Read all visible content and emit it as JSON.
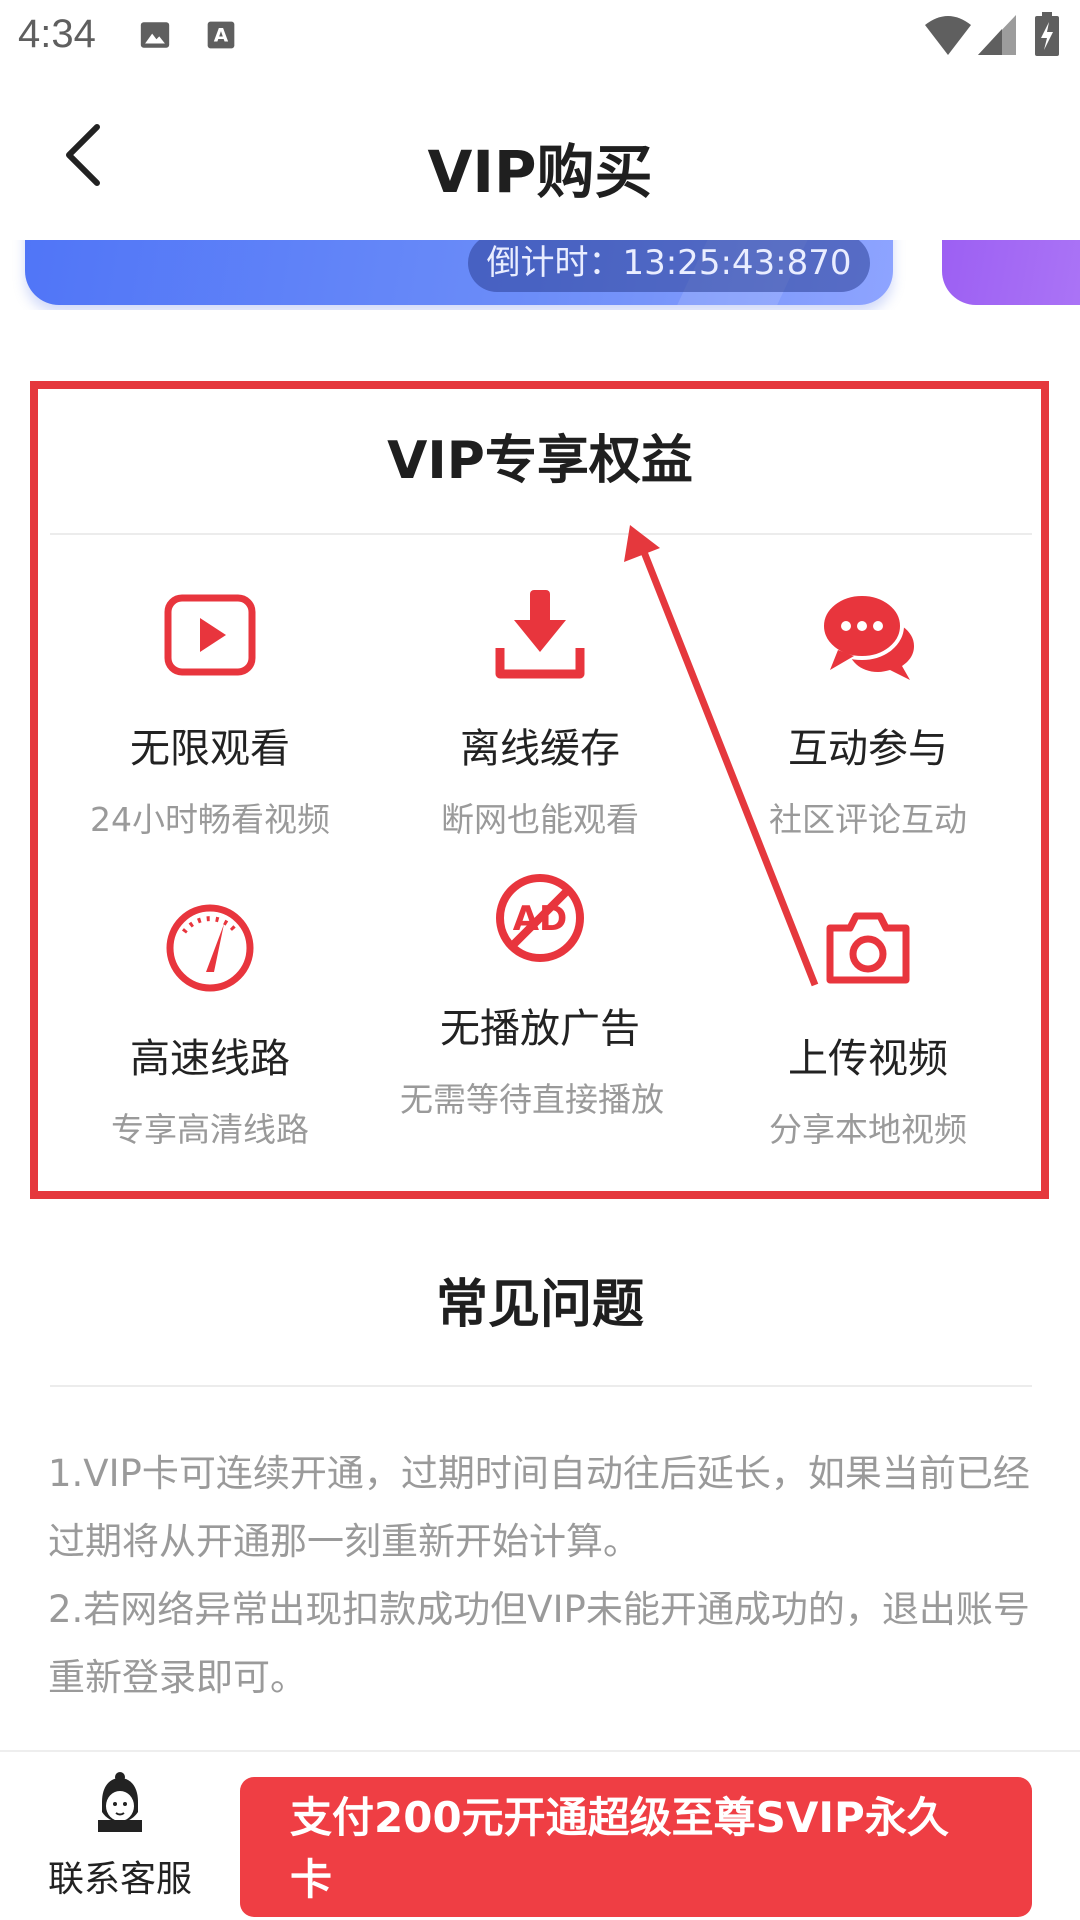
{
  "status_bar": {
    "time": "4:34",
    "icons": [
      "image-icon",
      "text-a-icon",
      "wifi-icon",
      "signal-icon",
      "battery-charging-icon"
    ]
  },
  "header": {
    "title": "VIP购买",
    "back_icon": "chevron-left-icon"
  },
  "promo_card": {
    "countdown": "倒计时：13:25:43:870"
  },
  "benefits": {
    "title": "VIP专享权益",
    "items": [
      {
        "icon": "play-icon",
        "name": "无限观看",
        "desc": "24小时畅看视频"
      },
      {
        "icon": "download-icon",
        "name": "离线缓存",
        "desc": "断网也能观看"
      },
      {
        "icon": "chat-bubbles-icon",
        "name": "互动参与",
        "desc": "社区评论互动"
      },
      {
        "icon": "speedometer-icon",
        "name": "高速线路",
        "desc": "专享高清线路"
      },
      {
        "icon": "no-ad-icon",
        "name": "无播放广告",
        "desc": "无需等待直接播放"
      },
      {
        "icon": "camera-icon",
        "name": "上传视频",
        "desc": "分享本地视频"
      }
    ]
  },
  "faq": {
    "title": "常见问题",
    "items": [
      "1.VIP卡可连续开通，过期时间自动往后延长，如果当前已经过期将从开通那一刻重新开始计算。",
      "2.若网络异常出现扣款成功但VIP未能开通成功的，退出账号重新登录即可。"
    ]
  },
  "bottom_bar": {
    "service_label": "联系客服",
    "service_icon": "customer-service-icon",
    "pay_label": "支付200元开通超级至尊SVIP永久卡"
  },
  "colors": {
    "accent_red": "#ef3e44",
    "icon_red": "#e8353d",
    "annotation_red": "#e5383d",
    "card_blue": "#5b7cf7",
    "card_purple": "#a36af5"
  }
}
